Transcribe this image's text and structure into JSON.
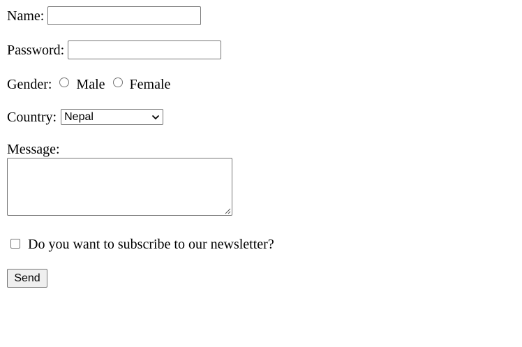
{
  "form": {
    "name_label": "Name:",
    "name_value": "",
    "password_label": "Password:",
    "password_value": "",
    "gender_label": "Gender:",
    "gender_options": [
      "Male",
      "Female"
    ],
    "country_label": "Country:",
    "country_selected": "Nepal",
    "message_label": "Message:",
    "message_value": "",
    "subscribe_label": "Do you want to subscribe to our newsletter?",
    "subscribe_checked": false,
    "send_label": "Send"
  },
  "icons": {
    "select_arrow": "chevron-down-icon",
    "textarea_resize": "resize-grip-icon"
  },
  "colors": {
    "border": "#767676",
    "button_bg": "#efefef",
    "background": "#ffffff",
    "text": "#000000"
  }
}
